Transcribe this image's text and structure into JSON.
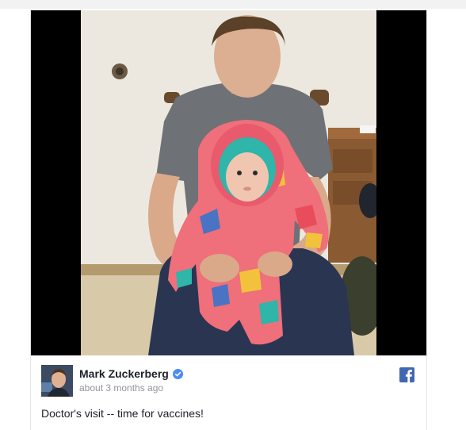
{
  "post": {
    "author_name": "Mark Zuckerberg",
    "verified_icon": "verified-check-icon",
    "timestamp": "about 3 months ago",
    "message": "Doctor's visit -- time for vaccines!",
    "platform_icon": "facebook-logo-icon"
  },
  "photo": {
    "subject": "photo-of-man-holding-baby-in-snowsuit"
  },
  "colors": {
    "media_background": "#000000",
    "facebook_blue": "#4267b2",
    "verified_blue": "#4c8cf5",
    "author_text": "#1d2129",
    "timestamp_text": "#90949c"
  }
}
